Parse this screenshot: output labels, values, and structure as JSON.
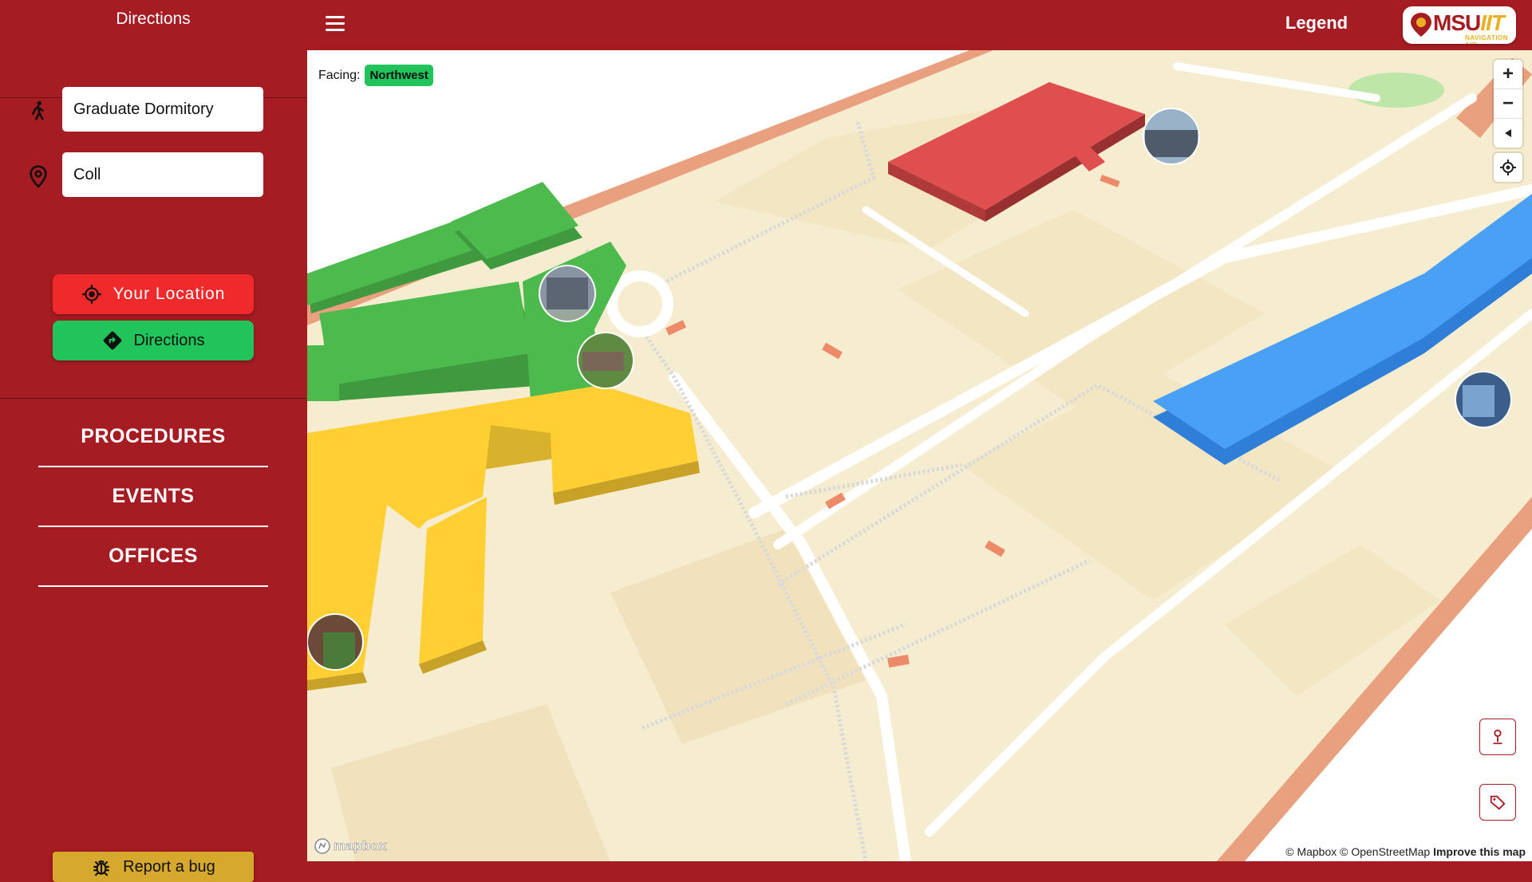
{
  "header": {
    "title": "Directions",
    "legend_label": "Legend",
    "logo": {
      "brand": "MSU",
      "brand_suffix": "IIT",
      "tagline": "NAVIGATION AID"
    }
  },
  "sidebar": {
    "origin": {
      "value": "Graduate Dormitory",
      "icon": "walking-person-icon"
    },
    "destination": {
      "value": "Coll",
      "icon": "map-pin-icon"
    },
    "your_location_label": "Your Location",
    "directions_label": "Directions",
    "nav": [
      "PROCEDURES",
      "EVENTS",
      "OFFICES"
    ],
    "report_bug_label": "Report a bug"
  },
  "map": {
    "facing_label": "Facing:",
    "facing_value": "Northwest",
    "controls": [
      "zoom-in",
      "zoom-out",
      "compass",
      "geolocate"
    ],
    "mapbox_logo": "mapbox",
    "attribution": {
      "mapbox": "© Mapbox",
      "osm": "© OpenStreetMap",
      "improve": "Improve this map"
    },
    "colors": {
      "accent": "#a51c22",
      "green": "#21c45a",
      "red_button": "#f02a2a",
      "bug_button": "#d6a92e"
    }
  }
}
